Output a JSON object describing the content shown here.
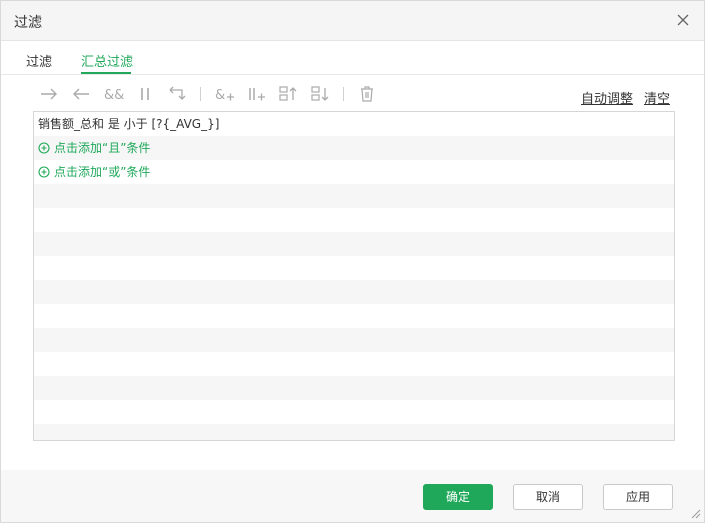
{
  "dialog": {
    "title": "过滤"
  },
  "tabs": [
    {
      "label": "过滤",
      "active": false
    },
    {
      "label": "汇总过滤",
      "active": true
    }
  ],
  "toolbar": {
    "icons": [
      "arrow-right-icon",
      "arrow-left-icon",
      "and-icon",
      "or-icon",
      "swap-icon",
      "add-and-icon",
      "add-or-icon",
      "move-up-icon",
      "move-down-icon",
      "delete-icon"
    ],
    "auto_adjust": "自动调整",
    "clear": "清空"
  },
  "conditions": [
    {
      "text": "销售额_总和 是 小于 [?{_AVG_}]"
    }
  ],
  "add_and": "点击添加“且”条件",
  "add_or": "点击添加“或”条件",
  "buttons": {
    "ok": "确定",
    "cancel": "取消",
    "apply": "应用"
  },
  "colors": {
    "accent": "#1fa85a"
  }
}
